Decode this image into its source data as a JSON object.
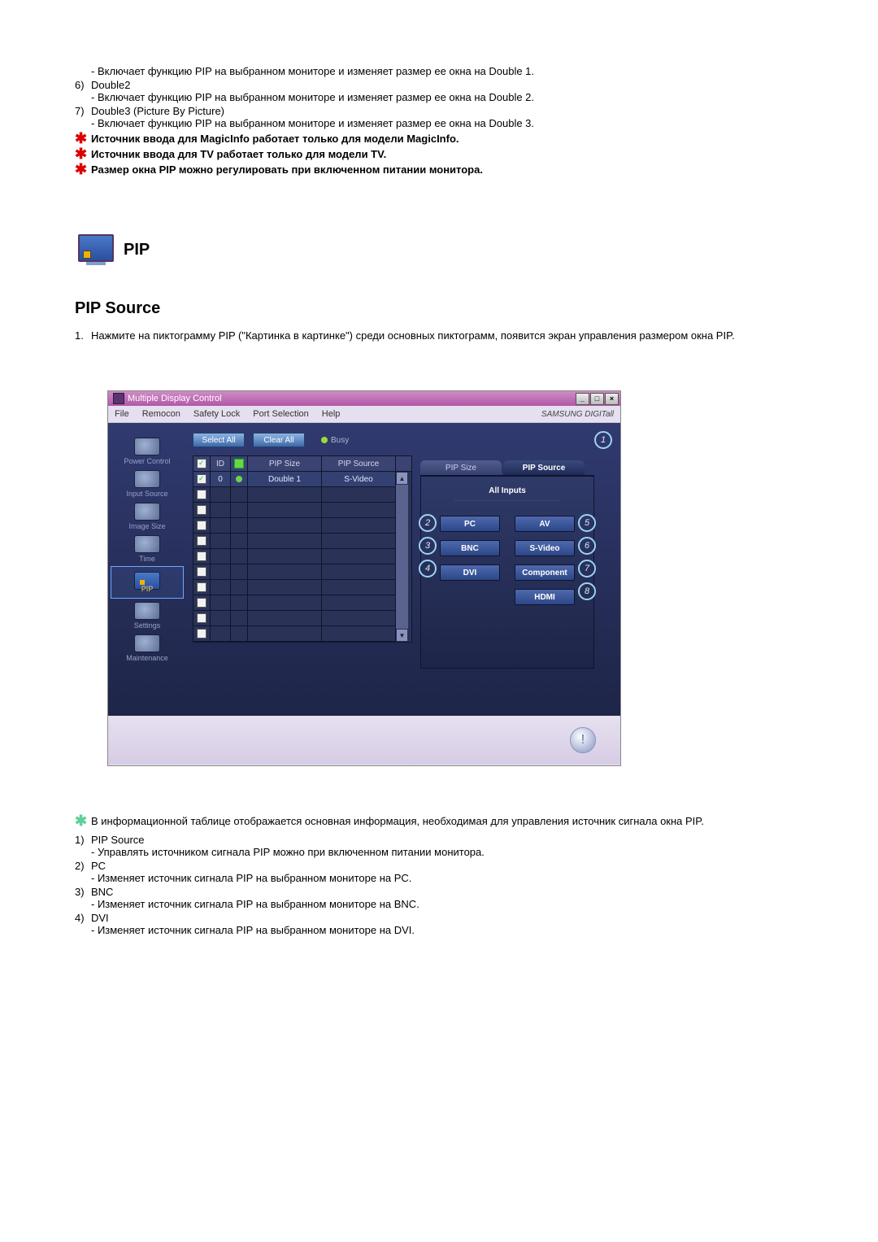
{
  "top": {
    "line0_desc": "- Включает функцию PIP на выбранном мониторе и изменяет размер ее окна на Double 1.",
    "item6_num": "6)",
    "item6_title": "Double2",
    "item6_desc": "- Включает функцию PIP на выбранном мониторе и изменяет размер ее окна на Double 2.",
    "item7_num": "7)",
    "item7_title": "Double3 (Picture By Picture)",
    "item7_desc": "- Включает функцию PIP на выбранном мониторе и изменяет размер ее окна на Double 3.",
    "note1": "Источник ввода для MagicInfo работает только для модели MagicInfo.",
    "note2": "Источник ввода для TV работает только для модели TV.",
    "note3": "Размер окна PIP можно регулировать при включенном питании монитора."
  },
  "pip_heading": "PIP",
  "section_heading": "PIP Source",
  "intro_num": "1.",
  "intro_text": "Нажмите на пиктограмму PIP (\"Картинка в картинке\") среди основных пиктограмм, появится экран управления размером окна PIP.",
  "app": {
    "title": "Multiple Display Control",
    "menu": {
      "file": "File",
      "remocon": "Remocon",
      "safety": "Safety Lock",
      "port": "Port Selection",
      "help": "Help"
    },
    "brand": "SAMSUNG DIGITall",
    "sidebar": {
      "power": "Power Control",
      "input": "Input Source",
      "image": "Image Size",
      "time": "Time",
      "pip": "PIP",
      "settings": "Settings",
      "maint": "Maintenance"
    },
    "select_all": "Select All",
    "clear_all": "Clear All",
    "busy": "Busy",
    "grid": {
      "h_id": "ID",
      "h_pipsize": "PIP Size",
      "h_pipsource": "PIP Source",
      "row1_id": "0",
      "row1_size": "Double 1",
      "row1_source": "S-Video"
    },
    "tabs": {
      "size": "PIP Size",
      "source": "PIP Source"
    },
    "panel_head": "All Inputs",
    "buttons": {
      "pc": "PC",
      "bnc": "BNC",
      "dvi": "DVI",
      "av": "AV",
      "svideo": "S-Video",
      "component": "Component",
      "hdmi": "HDMI"
    },
    "badges": {
      "b1": "1",
      "b2": "2",
      "b3": "3",
      "b4": "4",
      "b5": "5",
      "b6": "6",
      "b7": "7",
      "b8": "8"
    },
    "info": "!"
  },
  "bottom": {
    "note": "В информационной таблице отображается основная информация, необходимая для управления источник сигнала окна PIP.",
    "i1_num": "1)",
    "i1_title": "PIP Source",
    "i1_desc": "- Управлять источником сигнала PIP можно при включенном питании монитора.",
    "i2_num": "2)",
    "i2_title": "PC",
    "i2_desc": "- Изменяет источник сигнала PIP на выбранном мониторе на PC.",
    "i3_num": "3)",
    "i3_title": "BNC",
    "i3_desc": "- Изменяет источник сигнала PIP на выбранном мониторе на BNC.",
    "i4_num": "4)",
    "i4_title": "DVI",
    "i4_desc": "- Изменяет источник сигнала PIP на выбранном мониторе на DVI."
  }
}
